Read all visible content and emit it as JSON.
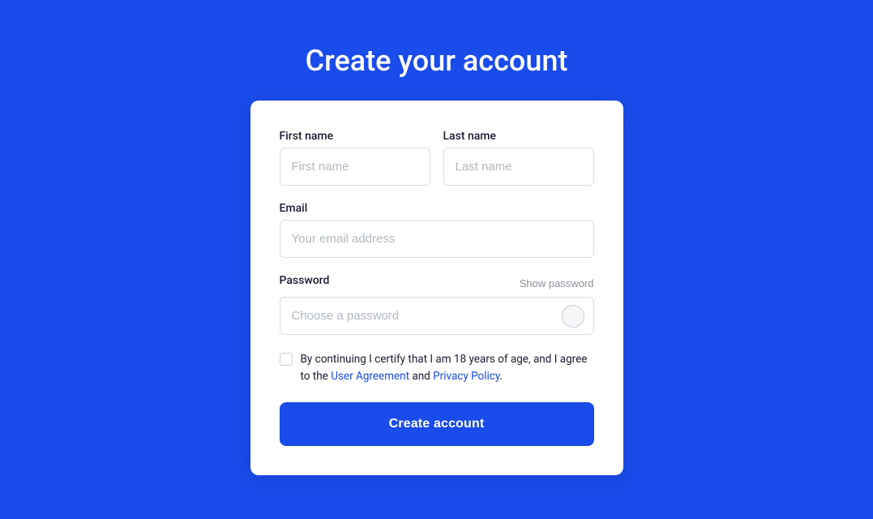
{
  "page": {
    "title": "Create your account",
    "background_color": "#1A4BEB"
  },
  "card": {
    "fields": {
      "first_name_label": "First name",
      "first_name_placeholder": "First name",
      "last_name_label": "Last name",
      "last_name_placeholder": "Last name",
      "email_label": "Email",
      "email_placeholder": "Your email address",
      "password_label": "Password",
      "password_placeholder": "Choose a password",
      "show_password_label": "Show password"
    },
    "checkbox": {
      "text_before_link1": "By continuing I certify that I am 18 years of age, and I agree to the ",
      "link1_text": "User Agreement",
      "text_between": " and ",
      "link2_text": "Privacy Policy",
      "text_after": "."
    },
    "submit_button_label": "Create account"
  }
}
